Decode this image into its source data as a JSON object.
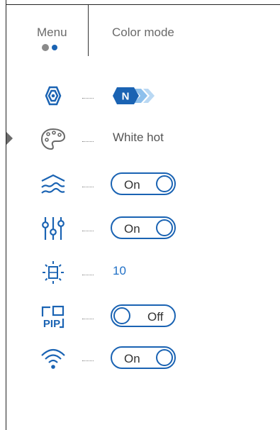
{
  "header": {
    "menu_label": "Menu",
    "title": "Color mode",
    "page_dots": {
      "count": 2,
      "active_index": 1
    }
  },
  "colors": {
    "accent": "#1a63b3",
    "text": "#555555",
    "dot_inactive": "#8a8a8a"
  },
  "rows": [
    {
      "id": "mode",
      "icon": "hexagon-nut-icon",
      "value_type": "badge",
      "badge_letter": "N"
    },
    {
      "id": "color-palette",
      "icon": "palette-icon",
      "value_type": "text",
      "value": "White hot"
    },
    {
      "id": "waves",
      "icon": "waves-icon",
      "value_type": "toggle",
      "value": "On"
    },
    {
      "id": "sliders",
      "icon": "sliders-icon",
      "value_type": "toggle",
      "value": "On"
    },
    {
      "id": "brightness",
      "icon": "brightness-square-icon",
      "value_type": "number",
      "value": "10"
    },
    {
      "id": "pip",
      "icon": "pip-icon",
      "value_type": "toggle",
      "value": "Off",
      "icon_text": "PIP"
    },
    {
      "id": "wifi",
      "icon": "wifi-icon",
      "value_type": "toggle",
      "value": "On"
    }
  ]
}
